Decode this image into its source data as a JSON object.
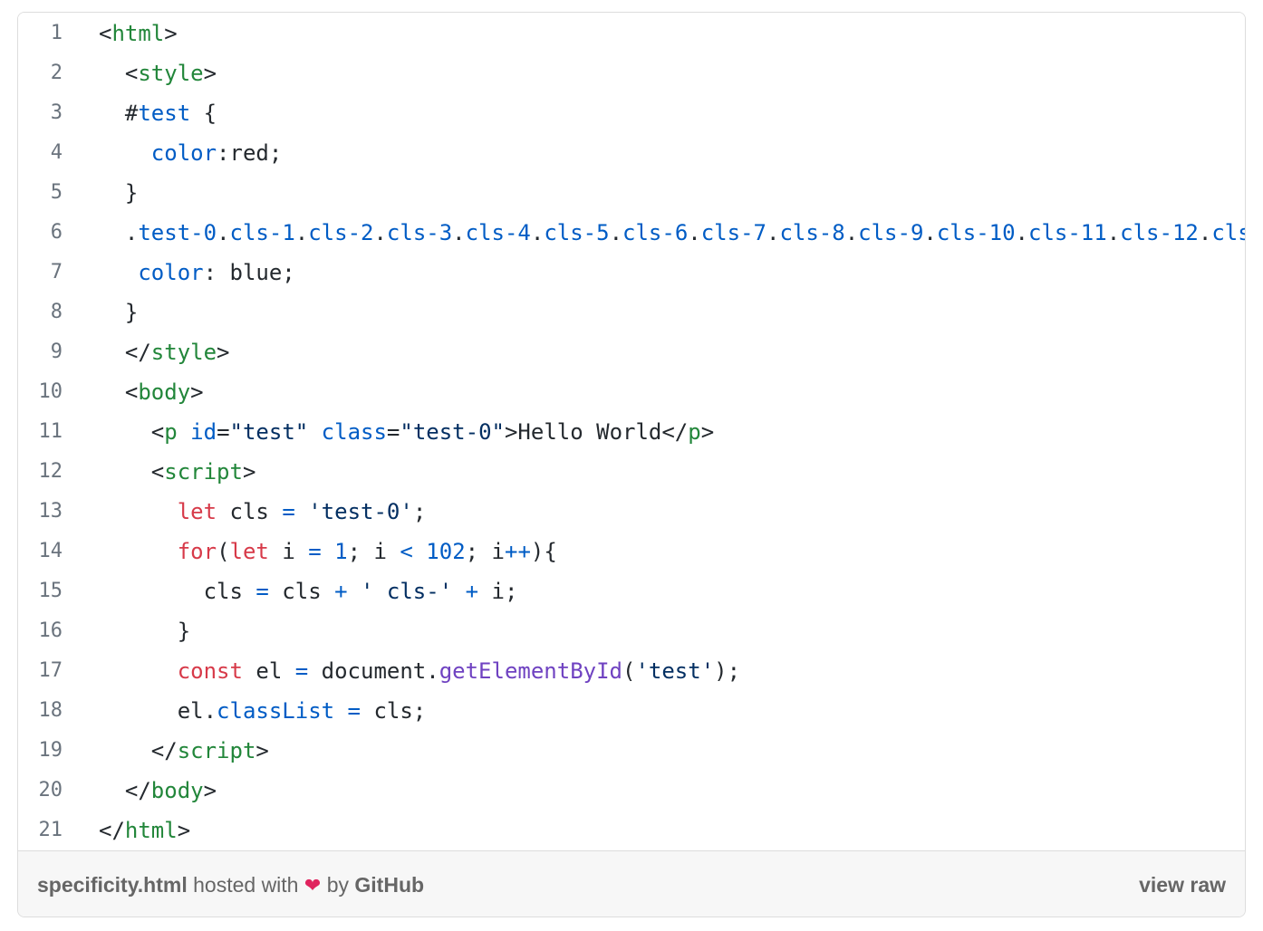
{
  "gist": {
    "lines": [
      {
        "n": "1",
        "tokens": [
          [
            "plain",
            "<"
          ],
          [
            "tag",
            "html"
          ],
          [
            "plain",
            ">"
          ]
        ]
      },
      {
        "n": "2",
        "tokens": [
          [
            "plain",
            "  <"
          ],
          [
            "tag",
            "style"
          ],
          [
            "plain",
            ">"
          ]
        ]
      },
      {
        "n": "3",
        "tokens": [
          [
            "plain",
            "  #"
          ],
          [
            "sel",
            "test"
          ],
          [
            "plain",
            " {"
          ]
        ]
      },
      {
        "n": "4",
        "tokens": [
          [
            "plain",
            "    "
          ],
          [
            "prop",
            "color"
          ],
          [
            "plain",
            ":red;"
          ]
        ]
      },
      {
        "n": "5",
        "tokens": [
          [
            "plain",
            "  }"
          ]
        ]
      },
      {
        "n": "6",
        "tokens": [
          [
            "plain",
            "  ."
          ],
          [
            "sel",
            "test-0"
          ],
          [
            "plain",
            "."
          ],
          [
            "sel",
            "cls-1"
          ],
          [
            "plain",
            "."
          ],
          [
            "sel",
            "cls-2"
          ],
          [
            "plain",
            "."
          ],
          [
            "sel",
            "cls-3"
          ],
          [
            "plain",
            "."
          ],
          [
            "sel",
            "cls-4"
          ],
          [
            "plain",
            "."
          ],
          [
            "sel",
            "cls-5"
          ],
          [
            "plain",
            "."
          ],
          [
            "sel",
            "cls-6"
          ],
          [
            "plain",
            "."
          ],
          [
            "sel",
            "cls-7"
          ],
          [
            "plain",
            "."
          ],
          [
            "sel",
            "cls-8"
          ],
          [
            "plain",
            "."
          ],
          [
            "sel",
            "cls-9"
          ],
          [
            "plain",
            "."
          ],
          [
            "sel",
            "cls-10"
          ],
          [
            "plain",
            "."
          ],
          [
            "sel",
            "cls-11"
          ],
          [
            "plain",
            "."
          ],
          [
            "sel",
            "cls-12"
          ],
          [
            "plain",
            "."
          ],
          [
            "sel",
            "cls"
          ]
        ]
      },
      {
        "n": "7",
        "tokens": [
          [
            "plain",
            "   "
          ],
          [
            "prop",
            "color"
          ],
          [
            "plain",
            ": blue;"
          ]
        ]
      },
      {
        "n": "8",
        "tokens": [
          [
            "plain",
            "  }"
          ]
        ]
      },
      {
        "n": "9",
        "tokens": [
          [
            "plain",
            "  </"
          ],
          [
            "tag",
            "style"
          ],
          [
            "plain",
            ">"
          ]
        ]
      },
      {
        "n": "10",
        "tokens": [
          [
            "plain",
            "  <"
          ],
          [
            "tag",
            "body"
          ],
          [
            "plain",
            ">"
          ]
        ]
      },
      {
        "n": "11",
        "tokens": [
          [
            "plain",
            "    <"
          ],
          [
            "tag",
            "p"
          ],
          [
            "plain",
            " "
          ],
          [
            "attr",
            "id"
          ],
          [
            "plain",
            "="
          ],
          [
            "str",
            "\"test\""
          ],
          [
            "plain",
            " "
          ],
          [
            "attr",
            "class"
          ],
          [
            "plain",
            "="
          ],
          [
            "str",
            "\"test-0\""
          ],
          [
            "plain",
            ">Hello World</"
          ],
          [
            "tag",
            "p"
          ],
          [
            "plain",
            ">"
          ]
        ]
      },
      {
        "n": "12",
        "tokens": [
          [
            "plain",
            "    <"
          ],
          [
            "tag",
            "script"
          ],
          [
            "plain",
            ">"
          ]
        ]
      },
      {
        "n": "13",
        "tokens": [
          [
            "plain",
            "      "
          ],
          [
            "kw",
            "let"
          ],
          [
            "plain",
            " cls "
          ],
          [
            "op",
            "="
          ],
          [
            "plain",
            " "
          ],
          [
            "str",
            "'test-0'"
          ],
          [
            "plain",
            ";"
          ]
        ]
      },
      {
        "n": "14",
        "tokens": [
          [
            "plain",
            "      "
          ],
          [
            "kw",
            "for"
          ],
          [
            "plain",
            "("
          ],
          [
            "kw",
            "let"
          ],
          [
            "plain",
            " i "
          ],
          [
            "op",
            "="
          ],
          [
            "plain",
            " "
          ],
          [
            "num",
            "1"
          ],
          [
            "plain",
            "; i "
          ],
          [
            "op",
            "<"
          ],
          [
            "plain",
            " "
          ],
          [
            "num",
            "102"
          ],
          [
            "plain",
            "; i"
          ],
          [
            "op",
            "++"
          ],
          [
            "plain",
            "){"
          ]
        ]
      },
      {
        "n": "15",
        "tokens": [
          [
            "plain",
            "        cls "
          ],
          [
            "op",
            "="
          ],
          [
            "plain",
            " cls "
          ],
          [
            "op",
            "+"
          ],
          [
            "plain",
            " "
          ],
          [
            "str",
            "' cls-'"
          ],
          [
            "plain",
            " "
          ],
          [
            "op",
            "+"
          ],
          [
            "plain",
            " i;"
          ]
        ]
      },
      {
        "n": "16",
        "tokens": [
          [
            "plain",
            "      }"
          ]
        ]
      },
      {
        "n": "17",
        "tokens": [
          [
            "plain",
            "      "
          ],
          [
            "kw",
            "const"
          ],
          [
            "plain",
            " el "
          ],
          [
            "op",
            "="
          ],
          [
            "plain",
            " document."
          ],
          [
            "fn",
            "getElementById"
          ],
          [
            "plain",
            "("
          ],
          [
            "str",
            "'test'"
          ],
          [
            "plain",
            ");"
          ]
        ]
      },
      {
        "n": "18",
        "tokens": [
          [
            "plain",
            "      el."
          ],
          [
            "prop",
            "classList"
          ],
          [
            "plain",
            " "
          ],
          [
            "op",
            "="
          ],
          [
            "plain",
            " cls;"
          ]
        ]
      },
      {
        "n": "19",
        "tokens": [
          [
            "plain",
            "    </"
          ],
          [
            "tag",
            "script"
          ],
          [
            "plain",
            ">"
          ]
        ]
      },
      {
        "n": "20",
        "tokens": [
          [
            "plain",
            "  </"
          ],
          [
            "tag",
            "body"
          ],
          [
            "plain",
            ">"
          ]
        ]
      },
      {
        "n": "21",
        "tokens": [
          [
            "plain",
            "</"
          ],
          [
            "tag",
            "html"
          ],
          [
            "plain",
            ">"
          ]
        ]
      }
    ]
  },
  "footer": {
    "filename": "specificity.html",
    "hosted_with": " hosted with ",
    "heart_icon": "heart-icon",
    "heart_glyph": "❤",
    "by": " by ",
    "github": "GitHub",
    "view_raw": "view raw"
  },
  "colors": {
    "tag": "#22863a",
    "attribute": "#005cc5",
    "string": "#032f62",
    "keyword": "#d73a49",
    "function": "#6f42c1",
    "line_number": "#6a737d",
    "footer_bg": "#f7f7f7"
  }
}
